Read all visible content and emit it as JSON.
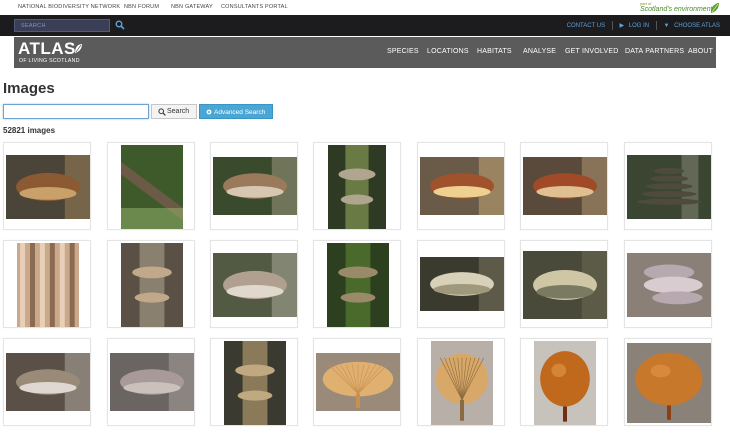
{
  "util_links": [
    "NATIONAL BIODIVERSITY NETWORK",
    "NBN FORUM",
    "NBN GATEWAY",
    "CONSULTANTS PORTAL"
  ],
  "brand": {
    "small": "part of",
    "main": "Scotland's environment"
  },
  "top_search": {
    "placeholder": "SEARCH",
    "icon": "search-icon"
  },
  "top_links": {
    "contact": "CONTACT US",
    "login": "LOG IN",
    "choose": "CHOOSE ATLAS"
  },
  "logo": {
    "main": "ATLAS",
    "sub": "OF LIVING SCOTLAND"
  },
  "nav": [
    "SPECIES",
    "LOCATIONS",
    "HABITATS",
    "ANALYSE",
    "GET INVOLVED",
    "DATA PARTNERS",
    "ABOUT"
  ],
  "page": {
    "title": "Images",
    "query_value": "",
    "search_label": "Search",
    "advanced_label": "Advanced Search",
    "count": "52821 images"
  },
  "colors": {
    "dark_bar": "#1c1c1e",
    "nav_bg": "#5b5b5b",
    "link_blue": "#5ea0d8",
    "accent_button": "#48a7d6"
  },
  "thumbnails": [
    {
      "bg": "#4a4538",
      "subject": "#8b5a32",
      "tone": "#c9a06a",
      "kind": "bracket"
    },
    {
      "bg": "#3f5a2a",
      "subject": "#6b5a45",
      "tone": "#9ab870",
      "kind": "log"
    },
    {
      "bg": "#3a4a2c",
      "subject": "#9a7a5a",
      "tone": "#d7c7b0",
      "kind": "bracket"
    },
    {
      "bg": "#2f3a24",
      "subject": "#b0a690",
      "tone": "#6a7a44",
      "kind": "trunk"
    },
    {
      "bg": "#6a5a48",
      "subject": "#a0522d",
      "tone": "#f0d090",
      "kind": "bracket"
    },
    {
      "bg": "#5a4a3c",
      "subject": "#a04a28",
      "tone": "#e0c090",
      "kind": "bracket"
    },
    {
      "bg": "#3a4632",
      "subject": "#4e4a3c",
      "tone": "#8a8a78",
      "kind": "tiered"
    },
    {
      "bg": "#caa88a",
      "subject": "#8a6a50",
      "tone": "#e8d0b8",
      "kind": "bark"
    },
    {
      "bg": "#5a5046",
      "subject": "#c0a888",
      "tone": "#8a8070",
      "kind": "trunk"
    },
    {
      "bg": "#525a44",
      "subject": "#b0a090",
      "tone": "#e0d8cc",
      "kind": "bracket"
    },
    {
      "bg": "#2c4020",
      "subject": "#9a8a6a",
      "tone": "#4a6a2c",
      "kind": "trunk"
    },
    {
      "bg": "#3a3a2e",
      "subject": "#d8d0b8",
      "tone": "#a0987a",
      "kind": "bracket"
    },
    {
      "bg": "#4a4a3a",
      "subject": "#cfc6a6",
      "tone": "#7a7a62",
      "kind": "bracket"
    },
    {
      "bg": "#8a8078",
      "subject": "#b8a8b0",
      "tone": "#d8ccd0",
      "kind": "cluster"
    },
    {
      "bg": "#5a5048",
      "subject": "#9a8a78",
      "tone": "#e0d8d0",
      "kind": "bracket"
    },
    {
      "bg": "#6a6462",
      "subject": "#a89a98",
      "tone": "#cac0bc",
      "kind": "bracket"
    },
    {
      "bg": "#3a3a30",
      "subject": "#c0a880",
      "tone": "#8a7a5a",
      "kind": "trunk"
    },
    {
      "bg": "#9a8a7a",
      "subject": "#e0b070",
      "tone": "#c89050",
      "kind": "gills"
    },
    {
      "bg": "#b8b0a8",
      "subject": "#d8a868",
      "tone": "#8a6a40",
      "kind": "gills"
    },
    {
      "bg": "#c8c2bc",
      "subject": "#c0681c",
      "tone": "#703010",
      "kind": "cap"
    },
    {
      "bg": "#8a8278",
      "subject": "#c8782a",
      "tone": "#8a4014",
      "kind": "cap"
    }
  ]
}
